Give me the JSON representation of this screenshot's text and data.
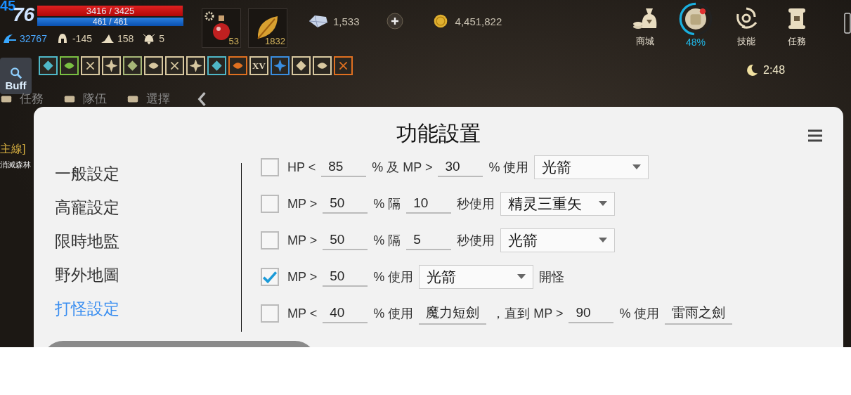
{
  "player": {
    "level_badge": "45",
    "level": "76",
    "hp": {
      "text": "3416 / 3425",
      "level": 0.997
    },
    "mp": {
      "text": "461 / 461",
      "level": 1
    }
  },
  "stats": [
    {
      "kind": "exp",
      "value": "32767"
    },
    {
      "kind": "armor",
      "value": "-145"
    },
    {
      "kind": "hat",
      "value": "158"
    },
    {
      "kind": "bell",
      "value": "5"
    }
  ],
  "items": [
    {
      "kind": "potion",
      "count": "53"
    },
    {
      "kind": "leaf",
      "count": "1832"
    }
  ],
  "currencies": [
    {
      "kind": "crystal",
      "value": "1,533"
    },
    {
      "kind": "add"
    },
    {
      "kind": "gold",
      "value": "4,451,822"
    }
  ],
  "menu": [
    {
      "kind": "shop",
      "label": "商城"
    },
    {
      "kind": "bag",
      "label": "48%",
      "level": 0.48
    },
    {
      "kind": "skill",
      "label": "技能"
    },
    {
      "kind": "quest",
      "label": "任務"
    }
  ],
  "buff_button": "Buff",
  "buffs": [
    {
      "color": "#4fb8c8"
    },
    {
      "color": "#7bc043"
    },
    {
      "color": "#d8c8a0"
    },
    {
      "color": "#d8c8a0"
    },
    {
      "color": "#a8b878"
    },
    {
      "color": "#d8c8a0"
    },
    {
      "color": "#d8c8a0"
    },
    {
      "color": "#d8c8a0"
    },
    {
      "color": "#4fb8c8"
    },
    {
      "color": "#e07020"
    },
    {
      "color": "#d8c8a0",
      "text": "XV"
    },
    {
      "color": "#3a8ee0"
    },
    {
      "color": "#d8c8a0"
    },
    {
      "color": "#d8c8a0"
    },
    {
      "color": "#e07020"
    }
  ],
  "clock": "2:48",
  "side_tabs": [
    {
      "label": "任務"
    },
    {
      "label": "隊伍"
    },
    {
      "label": "選擇"
    }
  ],
  "quest": {
    "tag": "主線]",
    "text": "消滅森林"
  },
  "panel": {
    "title": "功能設置",
    "nav": [
      {
        "label": "一般設定",
        "selected": false
      },
      {
        "label": "高寵設定",
        "selected": false
      },
      {
        "label": "限時地監",
        "selected": false
      },
      {
        "label": "野外地圖",
        "selected": false
      },
      {
        "label": "打怪設定",
        "selected": true
      }
    ],
    "rules": [
      {
        "checked": false,
        "parts": [
          {
            "kind": "text",
            "text": "HP <"
          },
          {
            "kind": "input",
            "text": "85"
          },
          {
            "kind": "text",
            "text": "% 及 MP >"
          },
          {
            "kind": "input",
            "text": "30"
          },
          {
            "kind": "text",
            "text": "% 使用"
          },
          {
            "kind": "select",
            "text": "光箭"
          }
        ]
      },
      {
        "checked": false,
        "parts": [
          {
            "kind": "text",
            "text": "MP >"
          },
          {
            "kind": "input",
            "text": "50"
          },
          {
            "kind": "text",
            "text": "% 隔"
          },
          {
            "kind": "input",
            "text": "10"
          },
          {
            "kind": "text",
            "text": "秒使用"
          },
          {
            "kind": "select",
            "text": "精灵三重矢"
          }
        ]
      },
      {
        "checked": false,
        "parts": [
          {
            "kind": "text",
            "text": "MP >"
          },
          {
            "kind": "input",
            "text": "50"
          },
          {
            "kind": "text",
            "text": "% 隔"
          },
          {
            "kind": "input",
            "text": "5"
          },
          {
            "kind": "text",
            "text": "秒使用"
          },
          {
            "kind": "select",
            "text": "光箭"
          }
        ]
      },
      {
        "checked": true,
        "parts": [
          {
            "kind": "text",
            "text": "MP >"
          },
          {
            "kind": "input",
            "text": "50"
          },
          {
            "kind": "text",
            "text": "% 使用"
          },
          {
            "kind": "select",
            "text": "光箭"
          },
          {
            "kind": "text",
            "text": "開怪"
          }
        ]
      },
      {
        "checked": false,
        "parts": [
          {
            "kind": "text",
            "text": "MP <"
          },
          {
            "kind": "input",
            "text": "40"
          },
          {
            "kind": "text",
            "text": "% 使用"
          },
          {
            "kind": "field",
            "text": "魔力短劍"
          },
          {
            "kind": "text",
            "text": "，直到 MP >"
          },
          {
            "kind": "input",
            "text": "90"
          },
          {
            "kind": "text",
            "text": "% 使用"
          },
          {
            "kind": "field",
            "text": "雷雨之劍"
          }
        ]
      }
    ]
  }
}
